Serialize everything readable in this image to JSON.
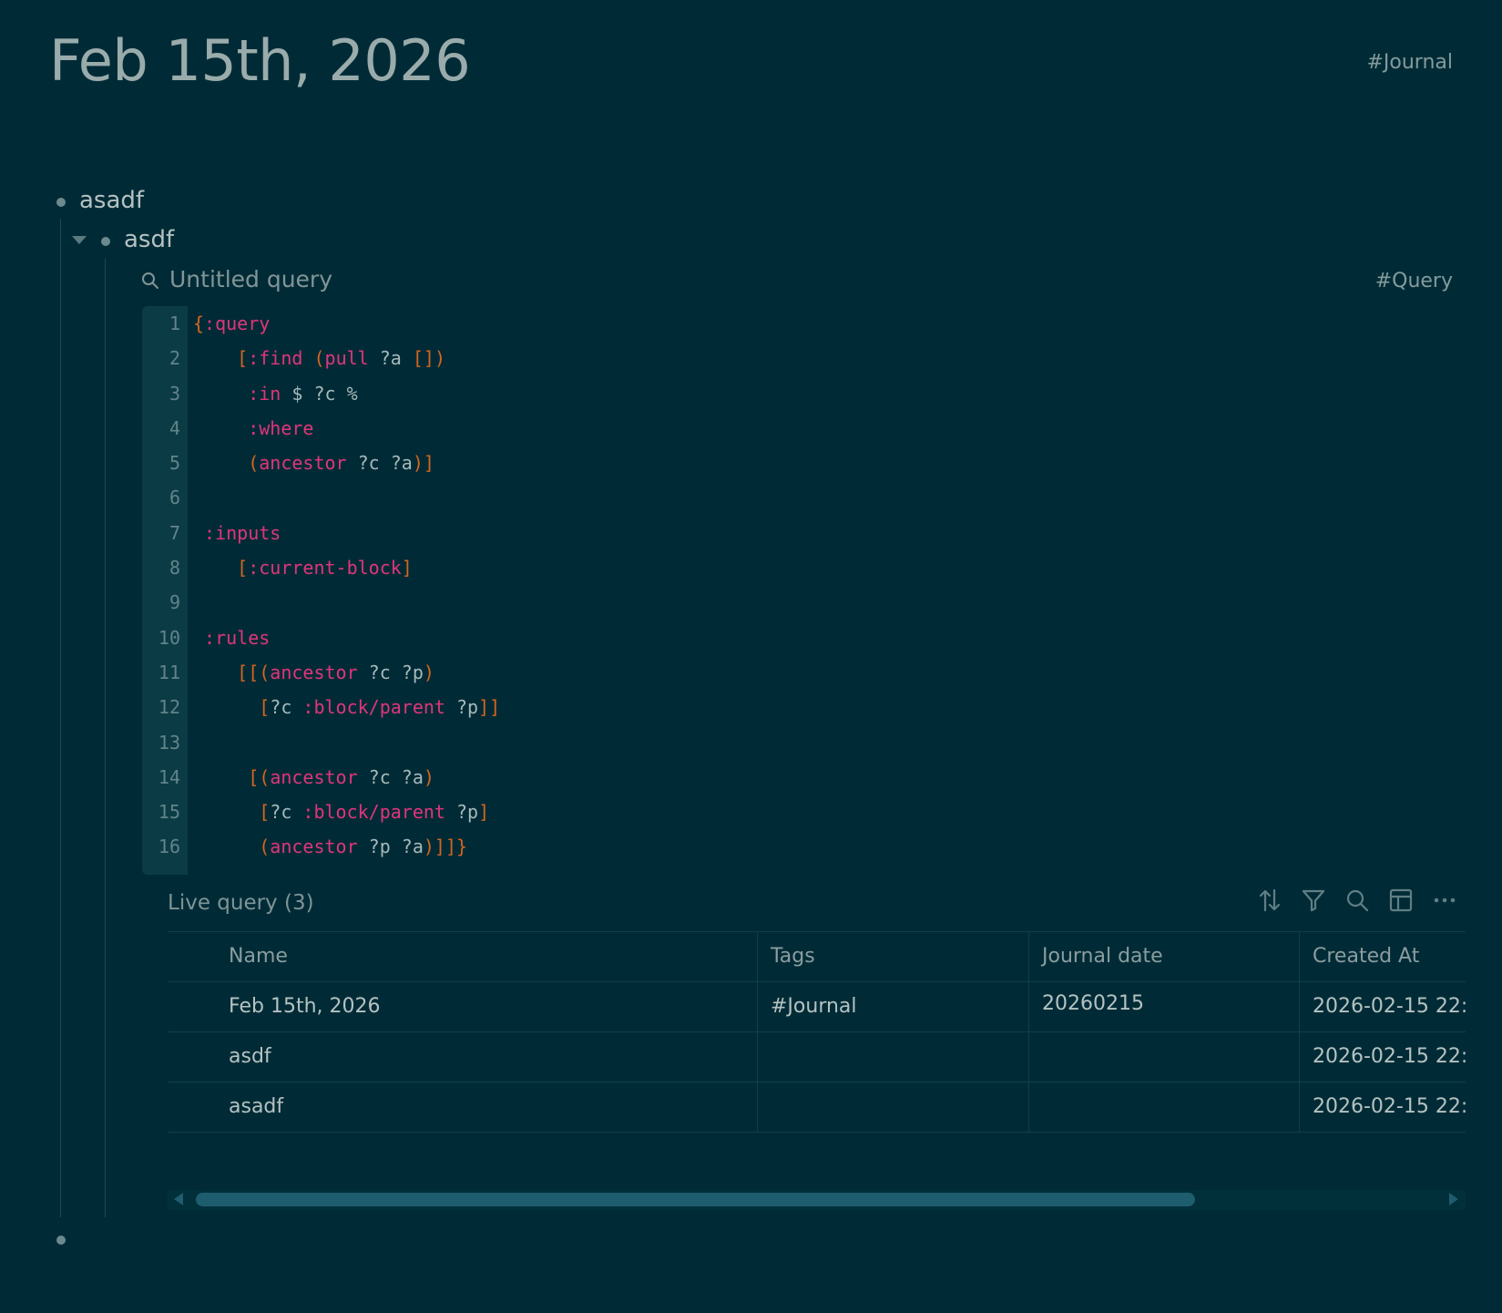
{
  "page": {
    "title": "Feb 15th, 2026",
    "tag": "#Journal"
  },
  "blocks": [
    {
      "text": "asadf"
    },
    {
      "text": "asdf"
    },
    {
      "text": ""
    }
  ],
  "query": {
    "title": "Untitled query",
    "tag": "#Query",
    "icon": "search-icon"
  },
  "code": {
    "lines": [
      {
        "n": "1",
        "tokens": [
          {
            "t": "{",
            "c": "p"
          },
          {
            "t": ":query",
            "c": "k"
          }
        ]
      },
      {
        "n": "2",
        "tokens": [
          {
            "t": "    ",
            "c": "v"
          },
          {
            "t": "[",
            "c": "p"
          },
          {
            "t": ":find",
            "c": "k"
          },
          {
            "t": " ",
            "c": "v"
          },
          {
            "t": "(",
            "c": "p"
          },
          {
            "t": "pull",
            "c": "k"
          },
          {
            "t": " ?a ",
            "c": "v"
          },
          {
            "t": "[])",
            "c": "p"
          }
        ]
      },
      {
        "n": "3",
        "tokens": [
          {
            "t": "     ",
            "c": "v"
          },
          {
            "t": ":in",
            "c": "k"
          },
          {
            "t": " $ ?c %",
            "c": "v"
          }
        ]
      },
      {
        "n": "4",
        "tokens": [
          {
            "t": "     ",
            "c": "v"
          },
          {
            "t": ":where",
            "c": "k"
          }
        ]
      },
      {
        "n": "5",
        "tokens": [
          {
            "t": "     ",
            "c": "v"
          },
          {
            "t": "(",
            "c": "p"
          },
          {
            "t": "ancestor",
            "c": "k"
          },
          {
            "t": " ?c ?a",
            "c": "v"
          },
          {
            "t": ")]",
            "c": "p"
          }
        ]
      },
      {
        "n": "6",
        "tokens": []
      },
      {
        "n": "7",
        "tokens": [
          {
            "t": " ",
            "c": "v"
          },
          {
            "t": ":inputs",
            "c": "k"
          }
        ]
      },
      {
        "n": "8",
        "tokens": [
          {
            "t": "    ",
            "c": "v"
          },
          {
            "t": "[",
            "c": "p"
          },
          {
            "t": ":current-block",
            "c": "k"
          },
          {
            "t": "]",
            "c": "p"
          }
        ]
      },
      {
        "n": "9",
        "tokens": []
      },
      {
        "n": "10",
        "tokens": [
          {
            "t": " ",
            "c": "v"
          },
          {
            "t": ":rules",
            "c": "k"
          }
        ]
      },
      {
        "n": "11",
        "tokens": [
          {
            "t": "    ",
            "c": "v"
          },
          {
            "t": "[[(",
            "c": "p"
          },
          {
            "t": "ancestor",
            "c": "k"
          },
          {
            "t": " ?c ?p",
            "c": "v"
          },
          {
            "t": ")",
            "c": "p"
          }
        ]
      },
      {
        "n": "12",
        "tokens": [
          {
            "t": "      ",
            "c": "v"
          },
          {
            "t": "[",
            "c": "p"
          },
          {
            "t": "?c ",
            "c": "v"
          },
          {
            "t": ":block/parent",
            "c": "k"
          },
          {
            "t": " ?p",
            "c": "v"
          },
          {
            "t": "]]",
            "c": "p"
          }
        ]
      },
      {
        "n": "13",
        "tokens": []
      },
      {
        "n": "14",
        "tokens": [
          {
            "t": "     ",
            "c": "v"
          },
          {
            "t": "[(",
            "c": "p"
          },
          {
            "t": "ancestor",
            "c": "k"
          },
          {
            "t": " ?c ?a",
            "c": "v"
          },
          {
            "t": ")",
            "c": "p"
          }
        ]
      },
      {
        "n": "15",
        "tokens": [
          {
            "t": "      ",
            "c": "v"
          },
          {
            "t": "[",
            "c": "p"
          },
          {
            "t": "?c ",
            "c": "v"
          },
          {
            "t": ":block/parent",
            "c": "k"
          },
          {
            "t": " ?p",
            "c": "v"
          },
          {
            "t": "]",
            "c": "p"
          }
        ]
      },
      {
        "n": "16",
        "tokens": [
          {
            "t": "      ",
            "c": "v"
          },
          {
            "t": "(",
            "c": "p"
          },
          {
            "t": "ancestor",
            "c": "k"
          },
          {
            "t": " ?p ?a",
            "c": "v"
          },
          {
            "t": ")]]}",
            "c": "p"
          }
        ]
      }
    ]
  },
  "live_query": {
    "label": "Live query (3)",
    "toolbar": [
      "sort-icon",
      "filter-icon",
      "search-icon",
      "table-view-icon",
      "more-icon"
    ]
  },
  "table": {
    "columns": [
      "Name",
      "Tags",
      "Journal date",
      "Created At"
    ],
    "rows": [
      [
        "Feb 15th, 2026",
        "#Journal",
        "20260215",
        "2026-02-15 22:"
      ],
      [
        "asdf",
        "",
        "",
        "2026-02-15 22:"
      ],
      [
        "asadf",
        "",
        "",
        "2026-02-15 22:"
      ]
    ]
  },
  "scrollbar": {
    "visible_fraction": 0.77,
    "scroll_position": 0
  },
  "colors": {
    "background": "#002b36",
    "keyword": "#e0357b",
    "bracket": "#d5651f",
    "scroll_thumb": "#1e5d6e"
  }
}
